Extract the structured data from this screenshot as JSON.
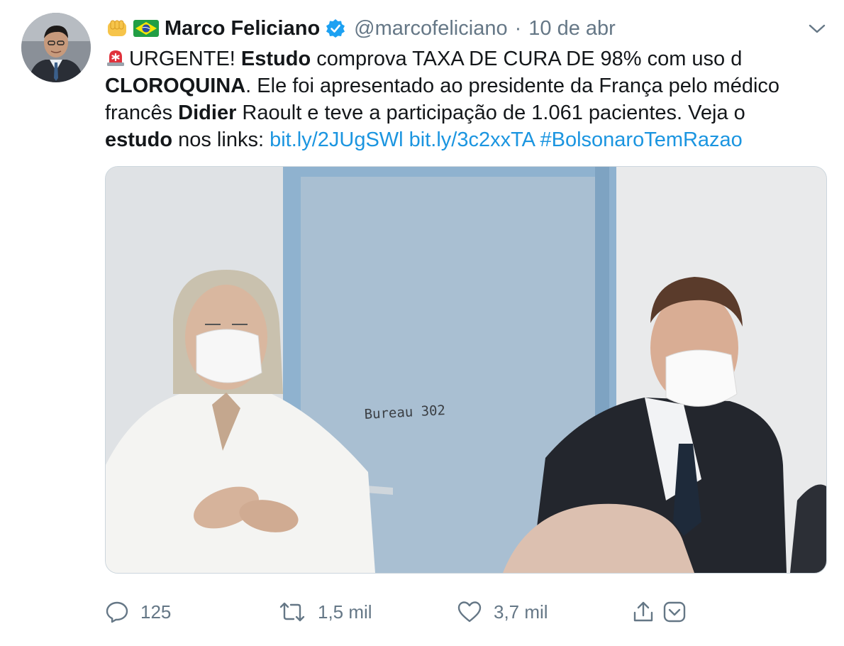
{
  "tweet": {
    "author_name": "Marco Feliciano",
    "handle": "@marcofeliciano",
    "separator": "·",
    "date": "10 de abr",
    "lines": [
      [
        {
          "t": "URGENTE! ",
          "b": false,
          "siren": true
        },
        {
          "t": "Estudo",
          "b": true
        },
        {
          "t": " comprova TAXA DE CURA DE 98% com uso d",
          "b": false
        }
      ],
      [
        {
          "t": "CLOROQUINA",
          "b": true
        },
        {
          "t": ". Ele foi apresentado ao presidente da França pelo médico",
          "b": false
        }
      ],
      [
        {
          "t": "francês ",
          "b": false
        },
        {
          "t": "Didier",
          "b": true
        },
        {
          "t": " Raoult e teve a participação de 1.061 pacientes. Veja o",
          "b": false
        }
      ],
      [
        {
          "t": "estudo",
          "b": true
        },
        {
          "t": " nos links: ",
          "b": false
        },
        {
          "t": "bit.ly/2JUgSWl",
          "link": true
        },
        {
          "t": " ",
          "b": false
        },
        {
          "t": "bit.ly/3c2xxTA",
          "link": true
        },
        {
          "t": " ",
          "b": false
        },
        {
          "t": "#BolsonaroTemRazao",
          "link": true
        }
      ]
    ],
    "media": {
      "door_sign": "Bureau 302"
    },
    "actions": {
      "replies": "125",
      "retweets": "1,5 mil",
      "likes": "3,7 mil"
    }
  },
  "icons": [
    "fist-emoji-icon",
    "brazil-flag-icon",
    "verified-badge-icon",
    "chevron-down-icon",
    "siren-emoji-icon",
    "reply-icon",
    "retweet-icon",
    "like-icon",
    "share-icon",
    "caret-down-icon"
  ],
  "colors": {
    "link": "#1b95e0",
    "muted": "#657786",
    "verified": "#1da1f2",
    "text": "#14171a"
  }
}
